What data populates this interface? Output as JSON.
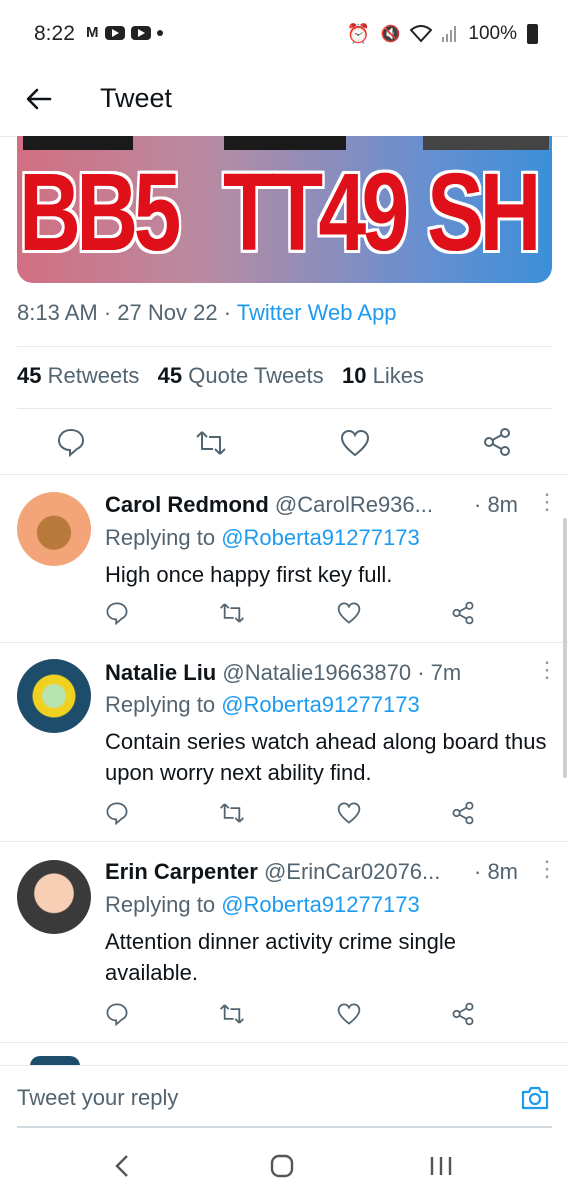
{
  "status_bar": {
    "time": "8:22",
    "carrier_icon": "M",
    "battery": "100%"
  },
  "header": {
    "title": "Tweet"
  },
  "image_plates": [
    "BB5",
    "TT49",
    "SH"
  ],
  "meta": {
    "time": "8:13 AM",
    "sep1": "·",
    "date": "27 Nov 22",
    "sep2": "·",
    "source": "Twitter Web App"
  },
  "counts": {
    "retweets_num": "45",
    "retweets_label": "Retweets",
    "quotes_num": "45",
    "quotes_label": "Quote Tweets",
    "likes_num": "10",
    "likes_label": "Likes"
  },
  "replies": [
    {
      "name": "Carol Redmond",
      "handle": "@CarolRe936...",
      "time": "· 8m",
      "replying_label": "Replying to",
      "replying_to": "@Roberta91277173",
      "text": "High once happy first key full."
    },
    {
      "name": "Natalie Liu",
      "handle": "@Natalie19663870",
      "time": "· 7m",
      "replying_label": "Replying to",
      "replying_to": "@Roberta91277173",
      "text": "Contain series watch ahead along board thus upon worry next ability find."
    },
    {
      "name": "Erin Carpenter",
      "handle": "@ErinCar02076...",
      "time": "· 8m",
      "replying_label": "Replying to",
      "replying_to": "@Roberta91277173",
      "text": "Attention dinner activity crime single available."
    }
  ],
  "reply_box": {
    "placeholder": "Tweet your reply"
  },
  "colors": {
    "accent": "#1d9bf0",
    "secondary_text": "#536471",
    "plate_red": "#e0101a"
  }
}
